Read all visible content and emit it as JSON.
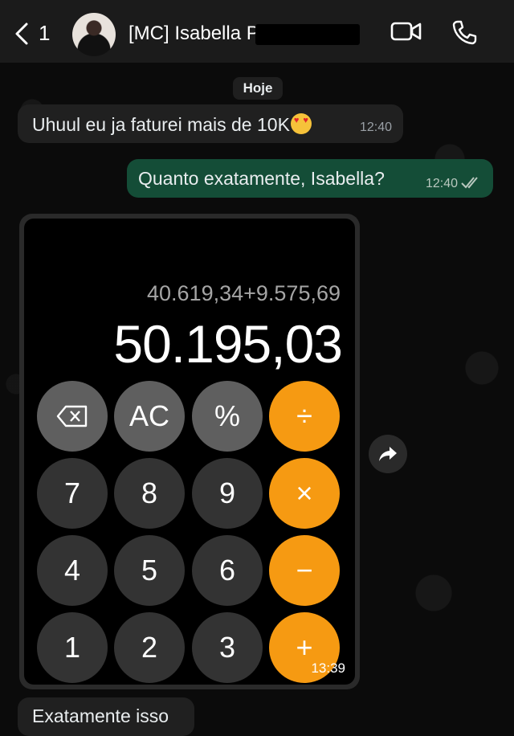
{
  "header": {
    "back_count": "1",
    "contact_name": "[MC] Isabella P",
    "icons": {
      "back": "chevron-left-icon",
      "video": "video-camera-icon",
      "call": "phone-icon"
    }
  },
  "chat": {
    "date_label": "Hoje",
    "messages": [
      {
        "direction": "incoming",
        "text": "Uhuul eu ja faturei mais de 10K",
        "emoji": "heart-eyes-emoji",
        "time": "12:40"
      },
      {
        "direction": "outgoing",
        "text": "Quanto exatamente, Isabella?",
        "time": "12:40",
        "status": "read"
      },
      {
        "direction": "incoming",
        "type": "image",
        "time": "13:39"
      },
      {
        "direction": "incoming",
        "text": "Exatamente isso"
      }
    ]
  },
  "calculator": {
    "expression": "40.619,34+9.575,69",
    "result": "50.195,03",
    "keys": [
      [
        "⌫",
        "AC",
        "%",
        "÷"
      ],
      [
        "7",
        "8",
        "9",
        "×"
      ],
      [
        "4",
        "5",
        "6",
        "−"
      ],
      [
        "1",
        "2",
        "3",
        "+"
      ]
    ]
  },
  "colors": {
    "header_bg": "#1b1b1b",
    "outgoing_bubble": "#144d37",
    "incoming_bubble": "#202020",
    "calc_orange": "#f69a12"
  }
}
